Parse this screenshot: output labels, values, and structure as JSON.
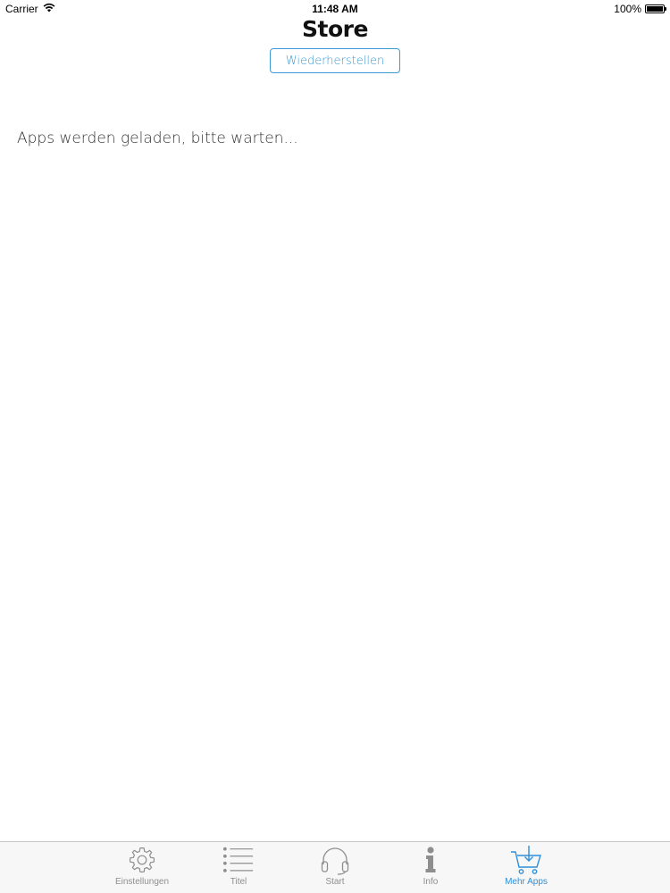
{
  "status_bar": {
    "carrier": "Carrier",
    "time": "11:48 AM",
    "battery": "100%",
    "battery_level": 1.0
  },
  "nav": {
    "title": "Store",
    "restore_label": "Wiederherstellen"
  },
  "main": {
    "loading_message": "Apps werden geladen, bitte warten..."
  },
  "tab_bar": {
    "tabs": [
      {
        "label": "Einstellungen",
        "icon": "gear-icon"
      },
      {
        "label": "Titel",
        "icon": "list-icon"
      },
      {
        "label": "Start",
        "icon": "headphones-icon"
      },
      {
        "label": "Info",
        "icon": "info-icon"
      },
      {
        "label": "Mehr Apps",
        "icon": "cart-download-icon",
        "active": true
      }
    ]
  },
  "colors": {
    "accent": "#3d9ad6",
    "tab_active": "#2f8fd8",
    "tab_inactive": "#8e8e8e",
    "tab_bar_bg": "#f7f7f7"
  }
}
